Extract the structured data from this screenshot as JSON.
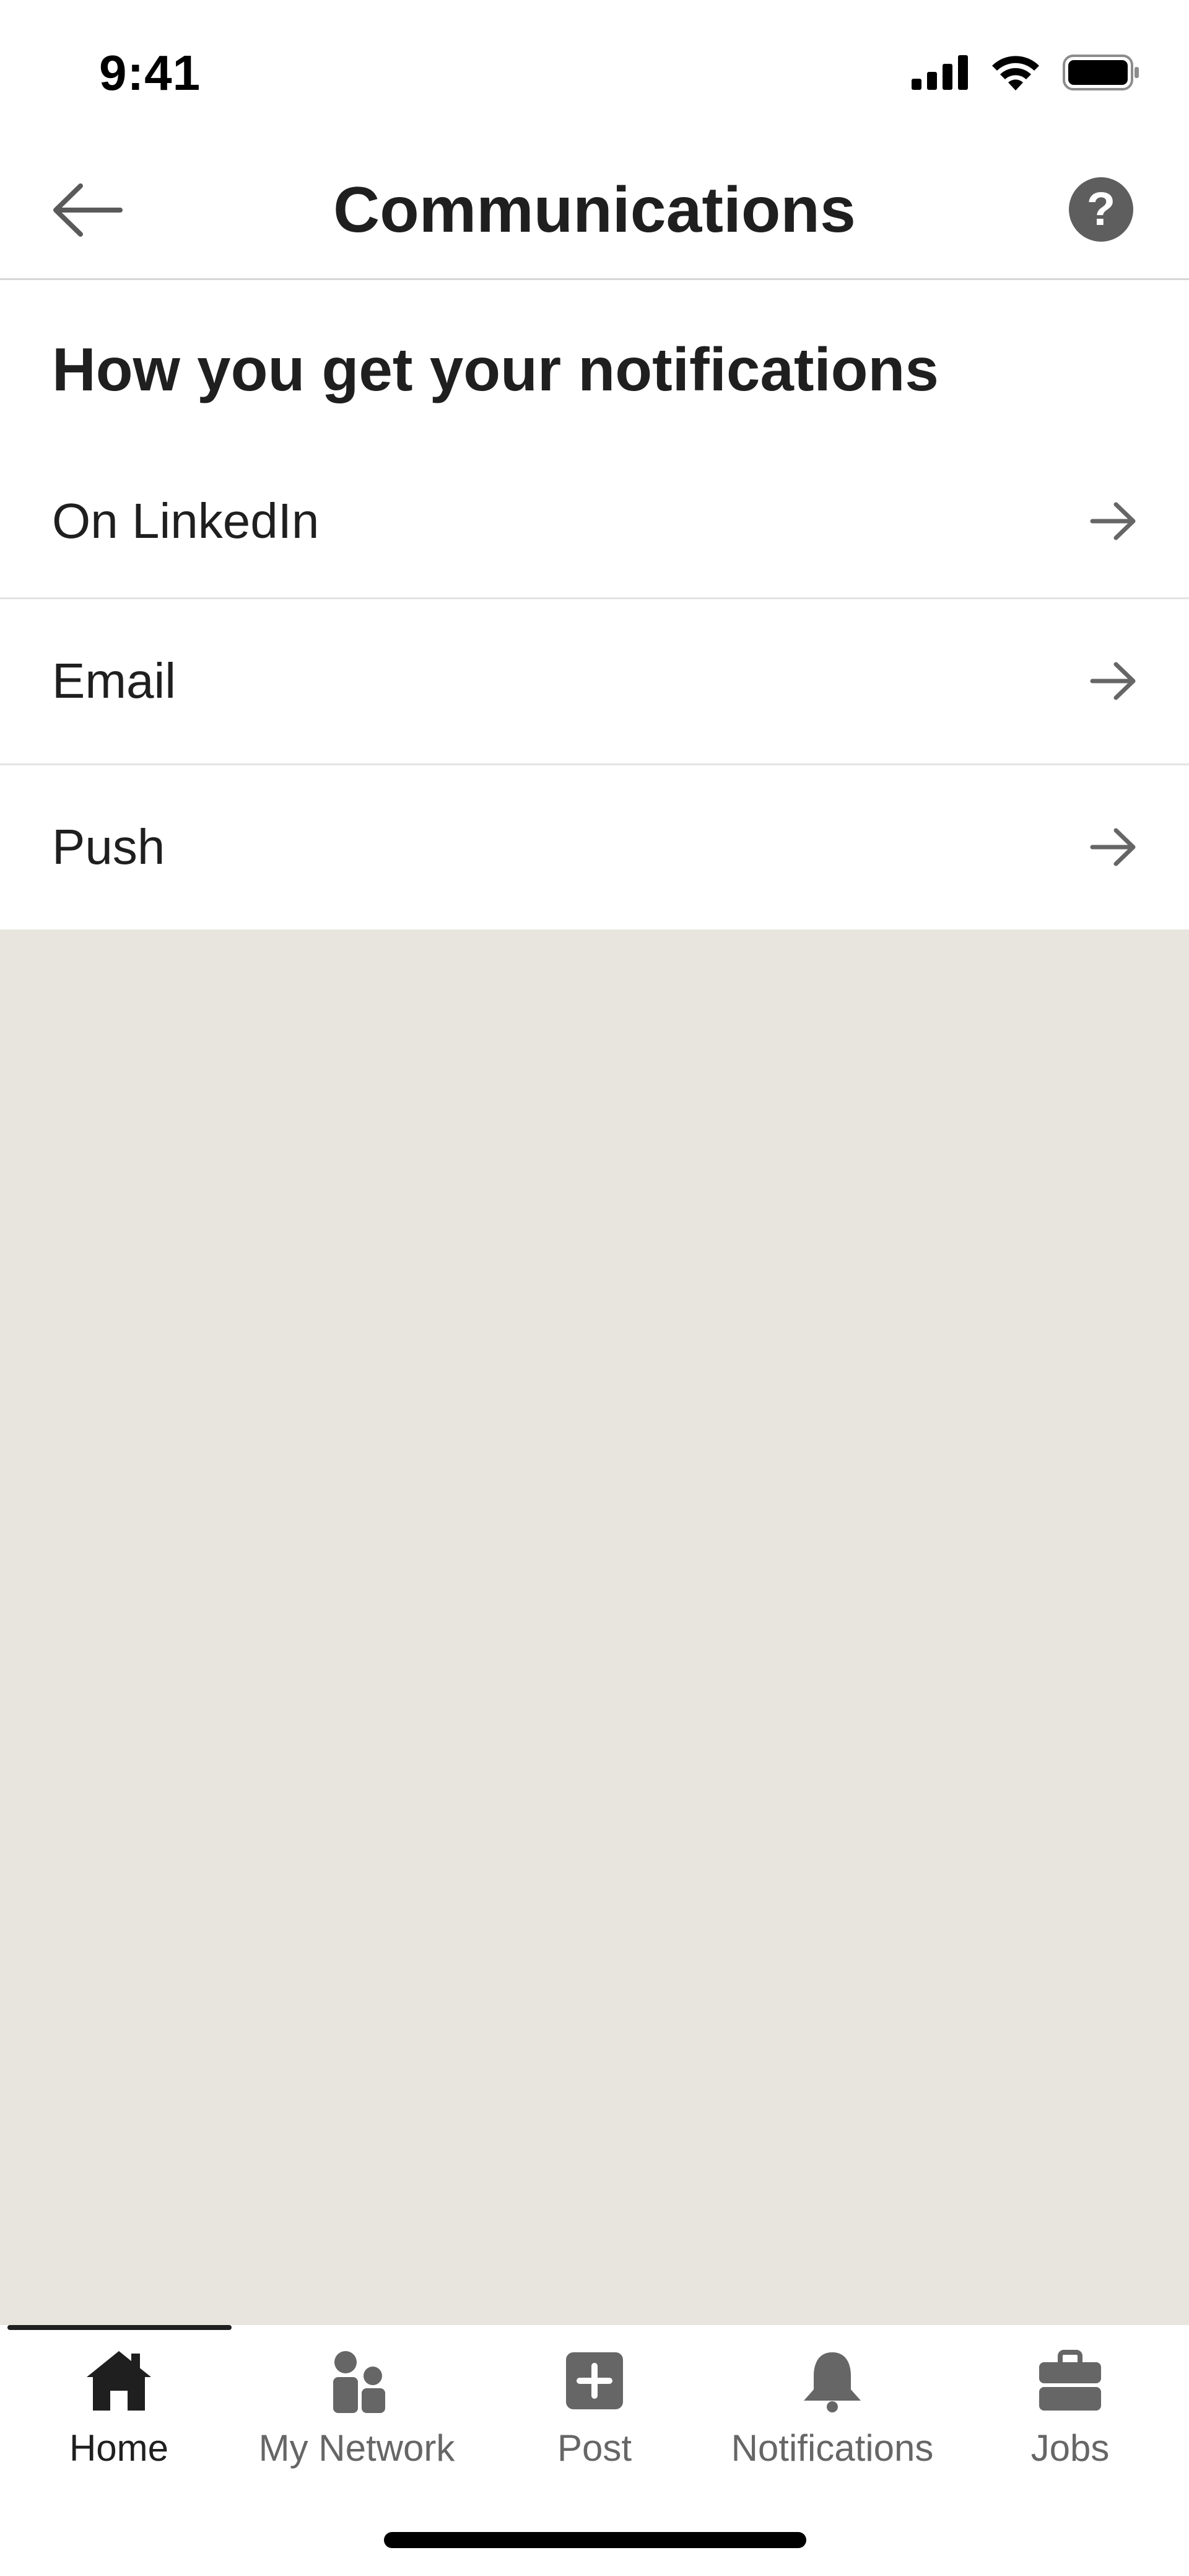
{
  "status_bar": {
    "time": "9:41"
  },
  "header": {
    "title": "Communications"
  },
  "section": {
    "heading": "How you get your notifications",
    "items": [
      {
        "label": "On LinkedIn"
      },
      {
        "label": "Email"
      },
      {
        "label": "Push"
      }
    ]
  },
  "tabs": [
    {
      "label": "Home",
      "icon": "home-icon",
      "active": true
    },
    {
      "label": "My Network",
      "icon": "my-network-icon",
      "active": false
    },
    {
      "label": "Post",
      "icon": "post-icon",
      "active": false
    },
    {
      "label": "Notifications",
      "icon": "bell-icon",
      "active": false
    },
    {
      "label": "Jobs",
      "icon": "briefcase-icon",
      "active": false
    }
  ],
  "colors": {
    "text": "#1f1f1f",
    "muted_icon": "#666666",
    "empty_background": "#e8e5de",
    "help_icon": "#5e5e5e"
  }
}
